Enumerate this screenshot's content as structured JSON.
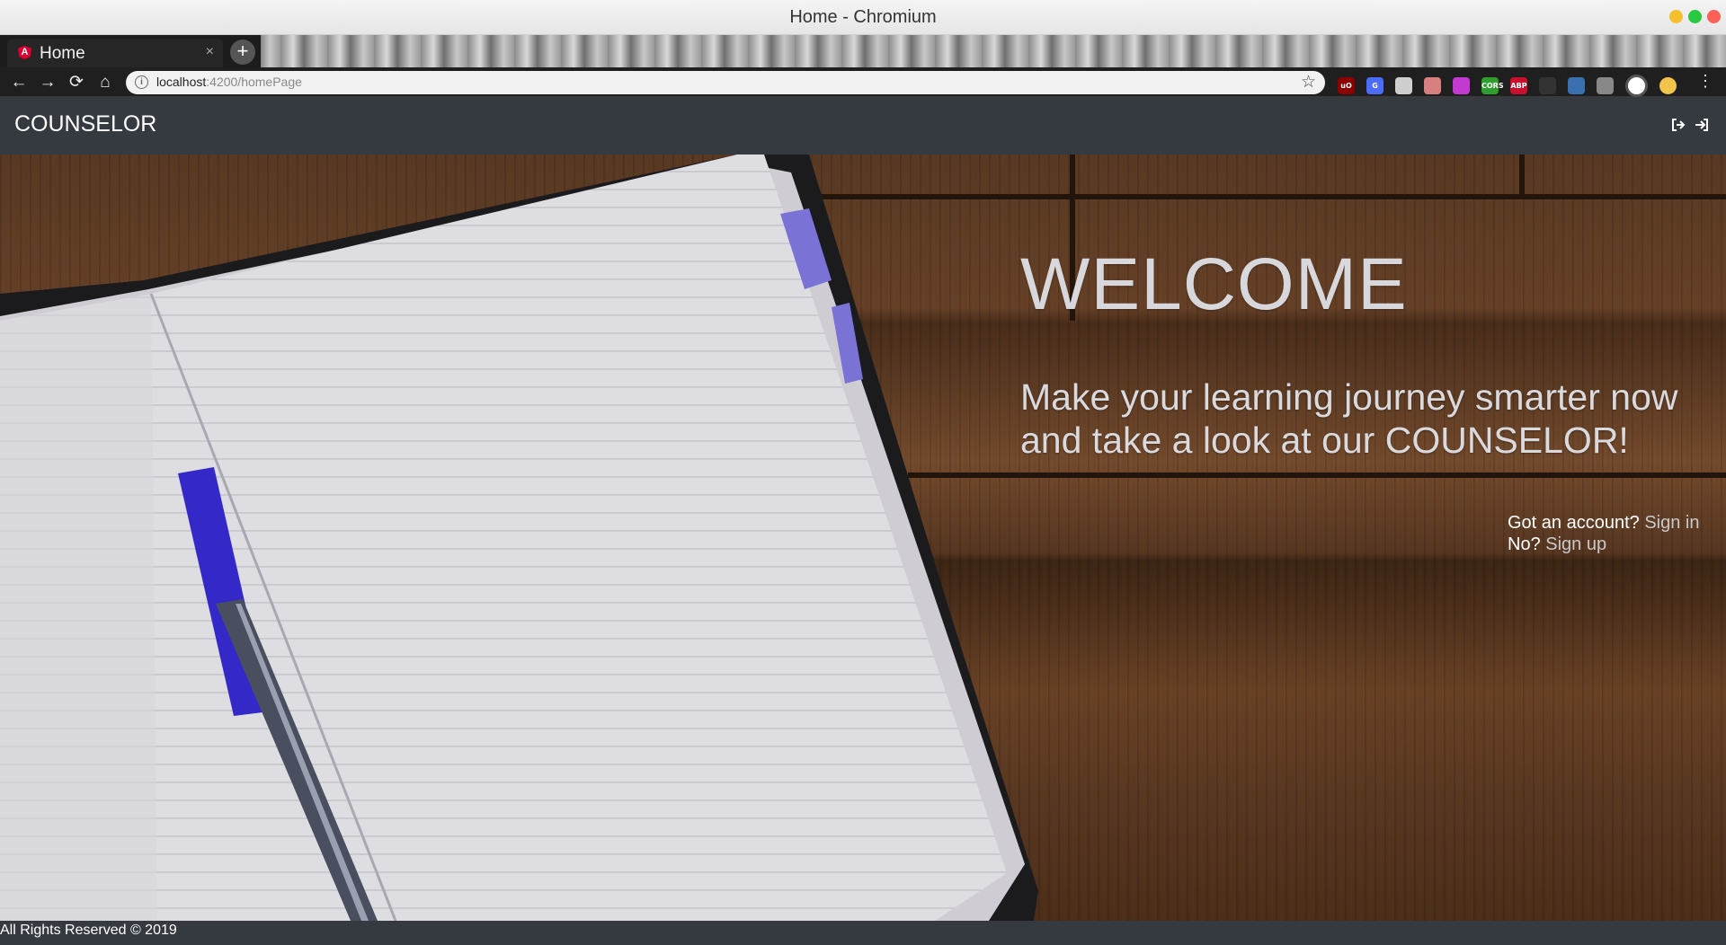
{
  "window": {
    "title": "Home - Chromium",
    "controls": {
      "minimize_color": "#f5bf2e",
      "maximize_color": "#28c840",
      "close_color": "#fe5f57"
    }
  },
  "tabs": [
    {
      "title": "Home",
      "favicon": "angular-icon",
      "favicon_letter": "A",
      "close": "×"
    }
  ],
  "new_tab_label": "+",
  "toolbar": {
    "back": "←",
    "forward": "→",
    "reload": "⟳",
    "home": "⌂",
    "address": {
      "host": "localhost",
      "path": ":4200/homePage"
    },
    "bookmark_star": "☆",
    "extensions": [
      {
        "name": "ublock-icon",
        "text": "uO",
        "color": "#8b0000"
      },
      {
        "name": "translate-icon",
        "text": "G",
        "color": "#4a6cf7"
      },
      {
        "name": "extension-icon-3",
        "text": "",
        "color": "#cfcfcf"
      },
      {
        "name": "pencil-icon",
        "text": "",
        "color": "#d88080"
      },
      {
        "name": "extension-icon-5",
        "text": "",
        "color": "#c43ad1"
      },
      {
        "name": "cors-icon",
        "text": "CORS",
        "color": "#2f9e2f"
      },
      {
        "name": "adblock-plus-icon",
        "text": "ABP",
        "color": "#c8102e"
      },
      {
        "name": "extension-icon-8",
        "text": "",
        "color": "#333333"
      },
      {
        "name": "extension-icon-9",
        "text": "",
        "color": "#3a6fb0"
      },
      {
        "name": "download-icon",
        "text": "",
        "color": "#888888"
      },
      {
        "name": "chrome-icon",
        "text": "",
        "color": "#ffffff"
      },
      {
        "name": "profile-avatar-icon",
        "text": "",
        "color": "#f2c44b"
      }
    ],
    "menu": "⋮"
  },
  "navbar": {
    "brand": "COUNSELOR",
    "icons": [
      "sign-out-icon",
      "sign-in-icon"
    ]
  },
  "hero": {
    "heading": "WELCOME",
    "tagline": "Make your learning journey smarter now and take a look at our COUNSELOR!",
    "account_prompt": "Got an account?",
    "sign_in": "Sign in",
    "no_prompt": "No?",
    "sign_up": "Sign up"
  },
  "footer": {
    "text": "All Rights Reserved © 2019"
  }
}
